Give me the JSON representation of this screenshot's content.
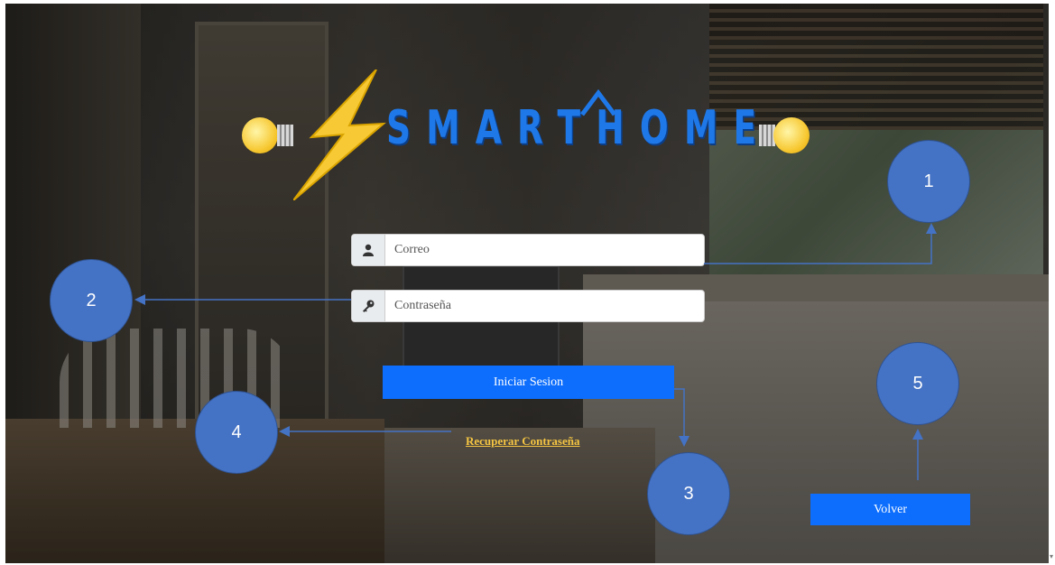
{
  "logo": {
    "word": "SMARTHOME"
  },
  "login": {
    "email_placeholder": "Correo",
    "password_placeholder": "Contraseña",
    "submit_label": "Iniciar Sesion",
    "recover_label": "Recuperar Contraseña",
    "back_label": "Volver"
  },
  "markers": [
    "1",
    "2",
    "3",
    "4",
    "5"
  ],
  "colors": {
    "accent": "#0d6efd",
    "logo_blue": "#1f78e8",
    "bolt": "#f7c934",
    "link": "#f5c542",
    "marker": "#4472c4"
  },
  "icons": {
    "email": "user-icon",
    "password": "key-icon"
  }
}
